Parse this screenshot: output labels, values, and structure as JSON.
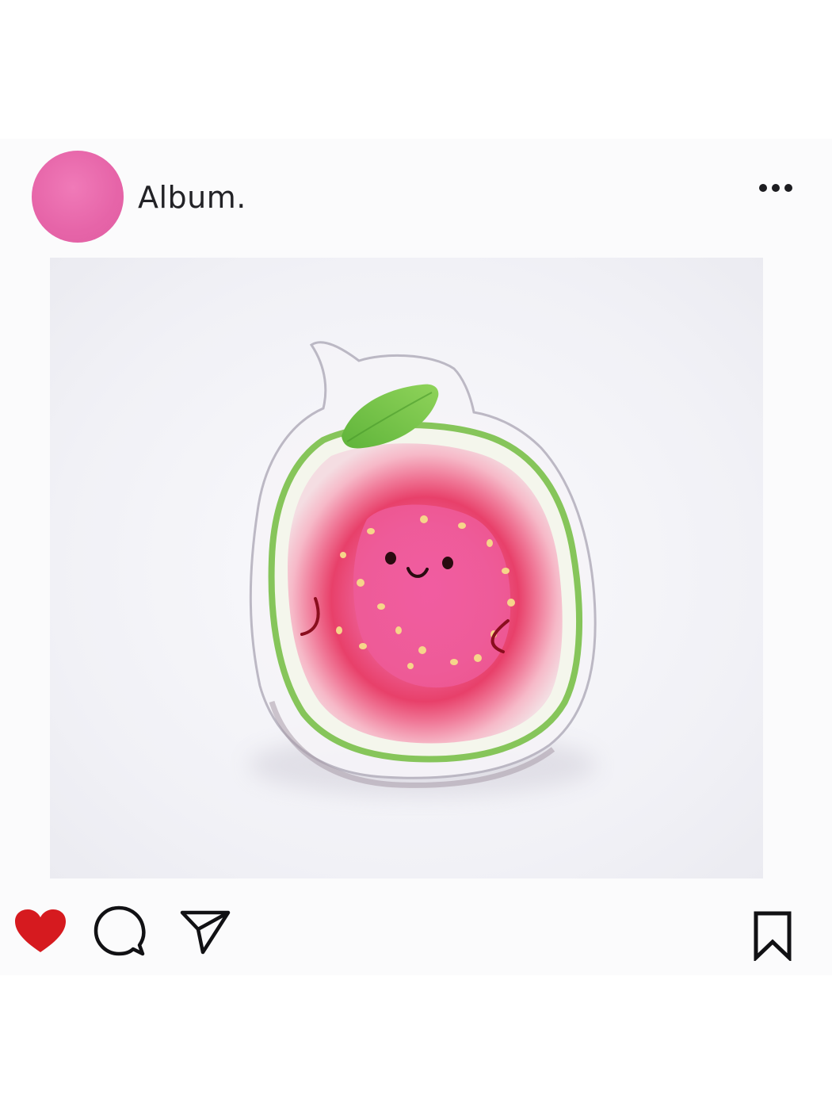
{
  "post": {
    "username": "Album.",
    "avatar_color": "#e664a8",
    "more_icon": "more-horizontal-icon"
  },
  "photo": {
    "subject": "guava-acrylic-pin"
  },
  "actions": {
    "like_icon": "heart-icon",
    "like_color": "#d61a1f",
    "liked": true,
    "comment_icon": "comment-icon",
    "share_icon": "send-icon",
    "save_icon": "bookmark-icon"
  }
}
